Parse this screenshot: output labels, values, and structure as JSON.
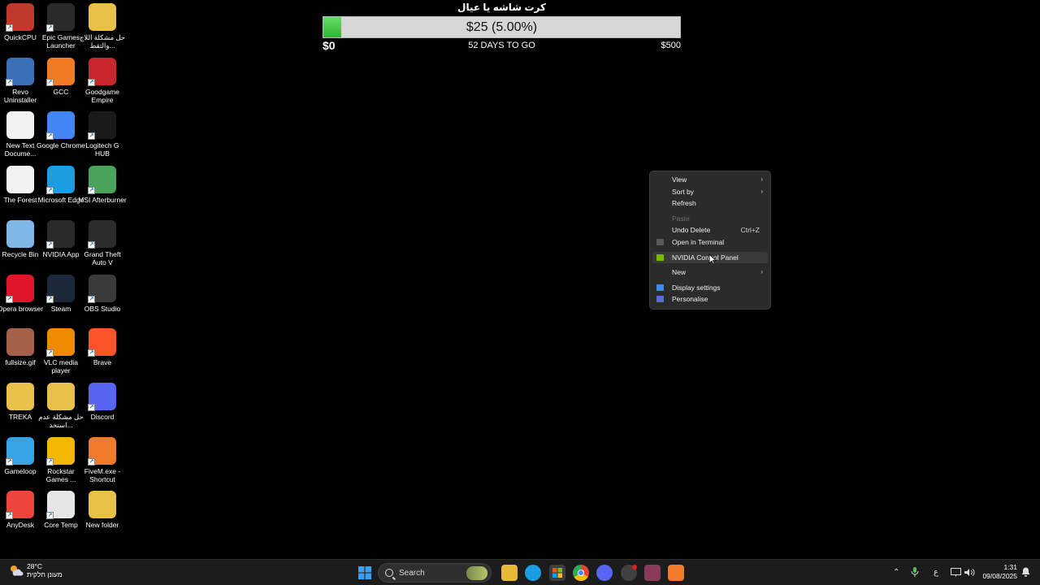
{
  "desktop": {
    "icons": [
      {
        "label": "QuickCPU",
        "icon": "quickcpu-icon",
        "color": "#c0392b"
      },
      {
        "label": "Epic Games Launcher",
        "icon": "epic-games-icon",
        "color": "#2a2a2a"
      },
      {
        "label": "حل مشكلة اللاج والتقط...",
        "icon": "folder-icon",
        "color": "#e8c04a"
      },
      {
        "label": "Revo Uninstaller",
        "icon": "revo-uninstaller-icon",
        "color": "#3b6fb6"
      },
      {
        "label": "GCC",
        "icon": "gcc-icon",
        "color": "#f07b22"
      },
      {
        "label": "Goodgame Empire",
        "icon": "goodgame-empire-icon",
        "color": "#c8262b"
      },
      {
        "label": "New Text Docume...",
        "icon": "text-document-icon",
        "color": "#f2f2f2"
      },
      {
        "label": "Google Chrome",
        "icon": "chrome-icon",
        "color": "#4285f4"
      },
      {
        "label": "Logitech G HUB",
        "icon": "logitech-ghub-icon",
        "color": "#1a1a1a"
      },
      {
        "label": "The Forest",
        "icon": "the-forest-icon",
        "color": "#f2f2f2"
      },
      {
        "label": "Microsoft Edge",
        "icon": "edge-icon",
        "color": "#1b9de2"
      },
      {
        "label": "MSI Afterburner",
        "icon": "msi-afterburner-icon",
        "color": "#4aa35a"
      },
      {
        "label": "Recycle Bin",
        "icon": "recycle-bin-icon",
        "color": "#7fb7e6"
      },
      {
        "label": "NVIDIA App",
        "icon": "nvidia-icon",
        "color": "#2a2a2a"
      },
      {
        "label": "Grand Theft Auto V",
        "icon": "gta-v-icon",
        "color": "#2c2c2c"
      },
      {
        "label": "Opera browser",
        "icon": "opera-icon",
        "color": "#e0162b"
      },
      {
        "label": "Steam",
        "icon": "steam-icon",
        "color": "#1b2838"
      },
      {
        "label": "OBS Studio",
        "icon": "obs-icon",
        "color": "#3a3a3a"
      },
      {
        "label": "fullsize.gif",
        "icon": "image-file-icon",
        "color": "#a5614c"
      },
      {
        "label": "VLC media player",
        "icon": "vlc-icon",
        "color": "#f08a00"
      },
      {
        "label": "Brave",
        "icon": "brave-icon",
        "color": "#fb542b"
      },
      {
        "label": "TREKA",
        "icon": "folder-icon",
        "color": "#e8c04a"
      },
      {
        "label": "حل مشكلة عدم استخد...",
        "icon": "folder-icon",
        "color": "#e8c04a"
      },
      {
        "label": "Discord",
        "icon": "discord-icon",
        "color": "#5865f2"
      },
      {
        "label": "Gameloop",
        "icon": "gameloop-icon",
        "color": "#36a3e6"
      },
      {
        "label": "Rockstar Games ...",
        "icon": "rockstar-icon",
        "color": "#f2b705"
      },
      {
        "label": "FiveM.exe - Shortcut",
        "icon": "fivem-icon",
        "color": "#f07c2b"
      },
      {
        "label": "AnyDesk",
        "icon": "anydesk-icon",
        "color": "#ef443b"
      },
      {
        "label": "Core Temp",
        "icon": "core-temp-icon",
        "color": "#e6e6e6"
      },
      {
        "label": "New folder",
        "icon": "folder-icon",
        "color": "#e8c04a"
      }
    ]
  },
  "goal": {
    "title": "كرت شاشه يا عيال",
    "amount_text": "$25 (5.00%)",
    "progress_percent": 5,
    "min_label": "$0",
    "days_label": "52 DAYS TO GO",
    "max_label": "$500",
    "fill_color": "#44c444"
  },
  "context_menu": {
    "items": [
      {
        "label": "View",
        "submenu": true
      },
      {
        "label": "Sort by",
        "submenu": true
      },
      {
        "label": "Refresh"
      },
      {
        "separator": true
      },
      {
        "label": "Paste",
        "disabled": true
      },
      {
        "label": "Undo Delete",
        "shortcut": "Ctrl+Z"
      },
      {
        "label": "Open in Terminal",
        "icon": "terminal-icon"
      },
      {
        "separator": true
      },
      {
        "label": "NVIDIA Control Panel",
        "icon": "nvidia-icon",
        "hover": true
      },
      {
        "separator": true
      },
      {
        "label": "New",
        "submenu": true
      },
      {
        "separator": true
      },
      {
        "label": "Display settings",
        "icon": "display-icon"
      },
      {
        "label": "Personalise",
        "icon": "personalise-icon"
      }
    ]
  },
  "taskbar": {
    "weather": {
      "temp": "28°C",
      "condition": "מעונן חלקית"
    },
    "search_label": "Search",
    "apps": [
      "start-icon",
      "search",
      "widgets-icon",
      "file-explorer-icon",
      "edge-icon",
      "microsoft-store-icon",
      "chrome-icon",
      "discord-icon",
      "app-icon",
      "winrar-icon",
      "fivem-icon"
    ],
    "tray": {
      "language": "ع"
    },
    "clock": {
      "time": "1:31",
      "date": "09/08/2025"
    }
  }
}
